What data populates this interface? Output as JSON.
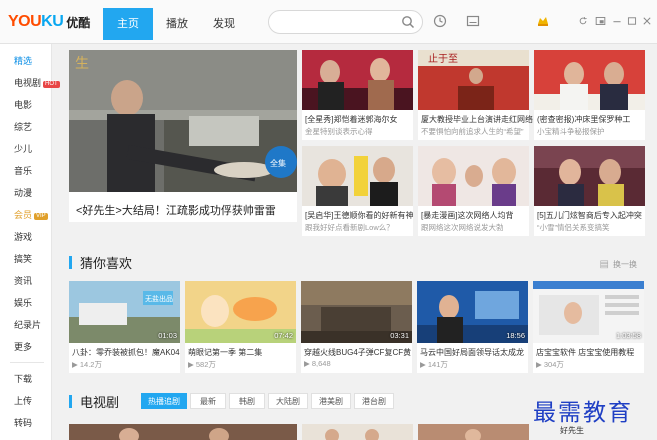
{
  "app": {
    "logo_brand_a": "YOU",
    "logo_brand_b": "KU",
    "logo_cn": "优酷"
  },
  "nav": {
    "tabs": [
      "主页",
      "播放",
      "发现"
    ],
    "active": 0
  },
  "search": {
    "placeholder": ""
  },
  "sidebar": {
    "items": [
      "精选",
      "电视剧",
      "电影",
      "综艺",
      "少儿",
      "音乐",
      "动漫",
      "会员",
      "游戏",
      "搞笑",
      "资讯",
      "娱乐",
      "纪录片",
      "更多"
    ],
    "hot_badge": "HOT",
    "vip_badge": "VIP",
    "bottom": [
      "下载",
      "上传",
      "转码"
    ]
  },
  "featured": {
    "title": "<好先生>大结局！江疏影成功俘获帅雷雷"
  },
  "grid": [
    {
      "title": "[全星秀]郑恺着迷郭海尔女",
      "sub": "金星特别谈表示心得"
    },
    {
      "title": "厦大教授毕业上台演讲走红网络",
      "sub": "不要惧怕向前追求人生的“希望”"
    },
    {
      "title": "(密查密报)冲床里保罗种工",
      "sub": "小宝精斗争秘报保护"
    },
    {
      "title": "[吴启华]王德顺你看的好新有神",
      "sub": "跟我好好点看新剧Low么？"
    },
    {
      "title": "[暴走漫画]这次网络人均背",
      "sub": "跟网络这次网络说发大勃"
    },
    {
      "title": "[5]五儿门炫智商后专入起冲突",
      "sub": "“小雪”情侣关系变搞笑"
    }
  ],
  "guess": {
    "title": "猜你喜欢",
    "refresh": "换一换",
    "items": [
      {
        "title": "八卦：零乔装被抓包！魔AK04",
        "views": "14.2万",
        "duration": "01:03"
      },
      {
        "title": "萌眼记第一季 第二集",
        "views": "582万",
        "duration": "07:42"
      },
      {
        "title": "穿越火线BUG4子弹CF复CF黄",
        "views": "8,648",
        "duration": "03:31"
      },
      {
        "title": "马云中国好局面领导话太成龙",
        "views": "141万",
        "duration": "18:56"
      },
      {
        "title": "店宝宝软件 店宝宝使用教程",
        "views": "304万",
        "duration": "1:03:58"
      }
    ]
  },
  "tv": {
    "title": "电视剧",
    "tabs": [
      "热播追剧",
      "最新",
      "韩剧",
      "大陆剧",
      "港美剧",
      "港台剧"
    ],
    "active": 0,
    "peek_item": "好先生"
  },
  "watermark": "最需教育",
  "colors": {
    "accent": "#22a7f0",
    "hot": "#e84646",
    "vip": "#e0a02b"
  }
}
